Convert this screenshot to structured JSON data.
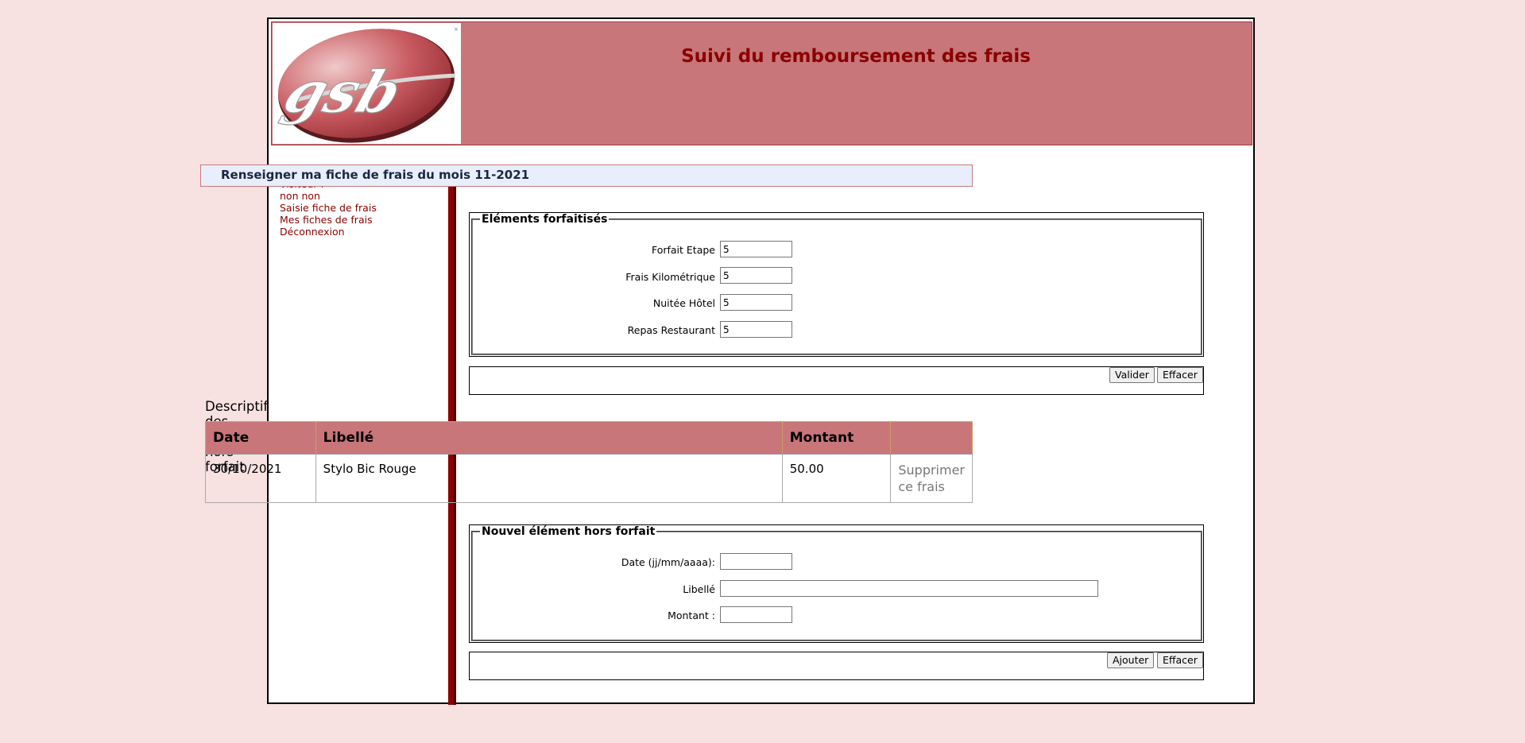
{
  "header": {
    "title": "Suivi du remboursement des frais",
    "logo_text": "gsb",
    "logo_colors": {
      "oval": "#b84950",
      "text": "#ffffff"
    }
  },
  "menu": {
    "visitor_label": "Visiteur :",
    "visitor_name": "non non",
    "items": [
      {
        "label": "Saisie fiche de frais"
      },
      {
        "label": "Mes fiches de frais"
      },
      {
        "label": "Déconnexion"
      }
    ]
  },
  "form": {
    "title": "Renseigner ma fiche de frais du mois 11-2021",
    "forfait_legend": "Eléments forfaitisés",
    "forfait_fields": [
      {
        "label": "Forfait Etape",
        "value": "5"
      },
      {
        "label": "Frais Kilométrique",
        "value": "5"
      },
      {
        "label": "Nuitée Hôtel",
        "value": "5"
      },
      {
        "label": "Repas Restaurant",
        "value": "5"
      }
    ],
    "validate_label": "Valider",
    "clear_label": "Effacer"
  },
  "hors_forfait": {
    "title": "Descriptif des éléments hors forfait",
    "columns": [
      "Date",
      "Libellé",
      "Montant",
      ""
    ],
    "rows": [
      {
        "date": "30/10/2021",
        "libelle": "Stylo Bic Rouge",
        "montant": "50.00",
        "action": "Supprimer ce frais"
      }
    ]
  },
  "new_element": {
    "legend": "Nouvel élément hors forfait",
    "date_label": "Date (jj/mm/aaaa):",
    "date_value": "",
    "libelle_label": "Libellé",
    "libelle_value": "",
    "montant_label": "Montant :",
    "montant_value": "",
    "add_label": "Ajouter",
    "clear_label": "Effacer"
  },
  "colors": {
    "page_bg": "#f7e1e1",
    "header_bg": "#c8767a",
    "accent": "#8b0000",
    "title_box_bg": "#e8eefb"
  }
}
